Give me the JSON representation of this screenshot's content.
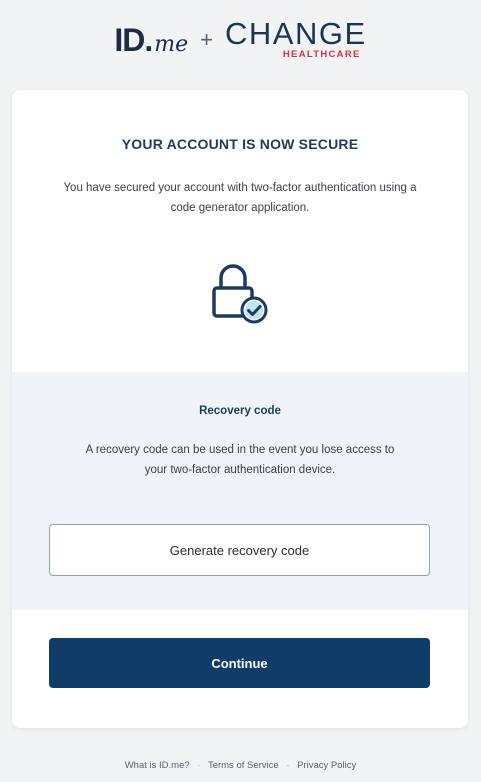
{
  "header": {
    "idme_logo": {
      "id": "ID",
      "dot": ".",
      "me": "me"
    },
    "plus": "+",
    "change_logo": {
      "main": "CHANGE",
      "sub": "HEALTHCARE"
    }
  },
  "card": {
    "title": "YOUR ACCOUNT IS NOW SECURE",
    "description": "You have secured your account with two-factor authentication using a code generator application.",
    "icon": "lock-check-icon",
    "recovery": {
      "title": "Recovery code",
      "description": "A recovery code can be used in the event you lose access to your two-factor authentication device.",
      "button_label": "Generate recovery code"
    },
    "continue_label": "Continue"
  },
  "footer": {
    "links": [
      "What is ID.me?",
      "Terms of Service",
      "Privacy Policy"
    ],
    "separator": "·"
  },
  "colors": {
    "primary_navy": "#0f3c69",
    "title_navy": "#1d3b5f",
    "brand_red": "#d93045",
    "check_teal": "#3fa9d6",
    "recovery_bg": "#eef4fa",
    "page_bg": "#f2f3f5"
  }
}
